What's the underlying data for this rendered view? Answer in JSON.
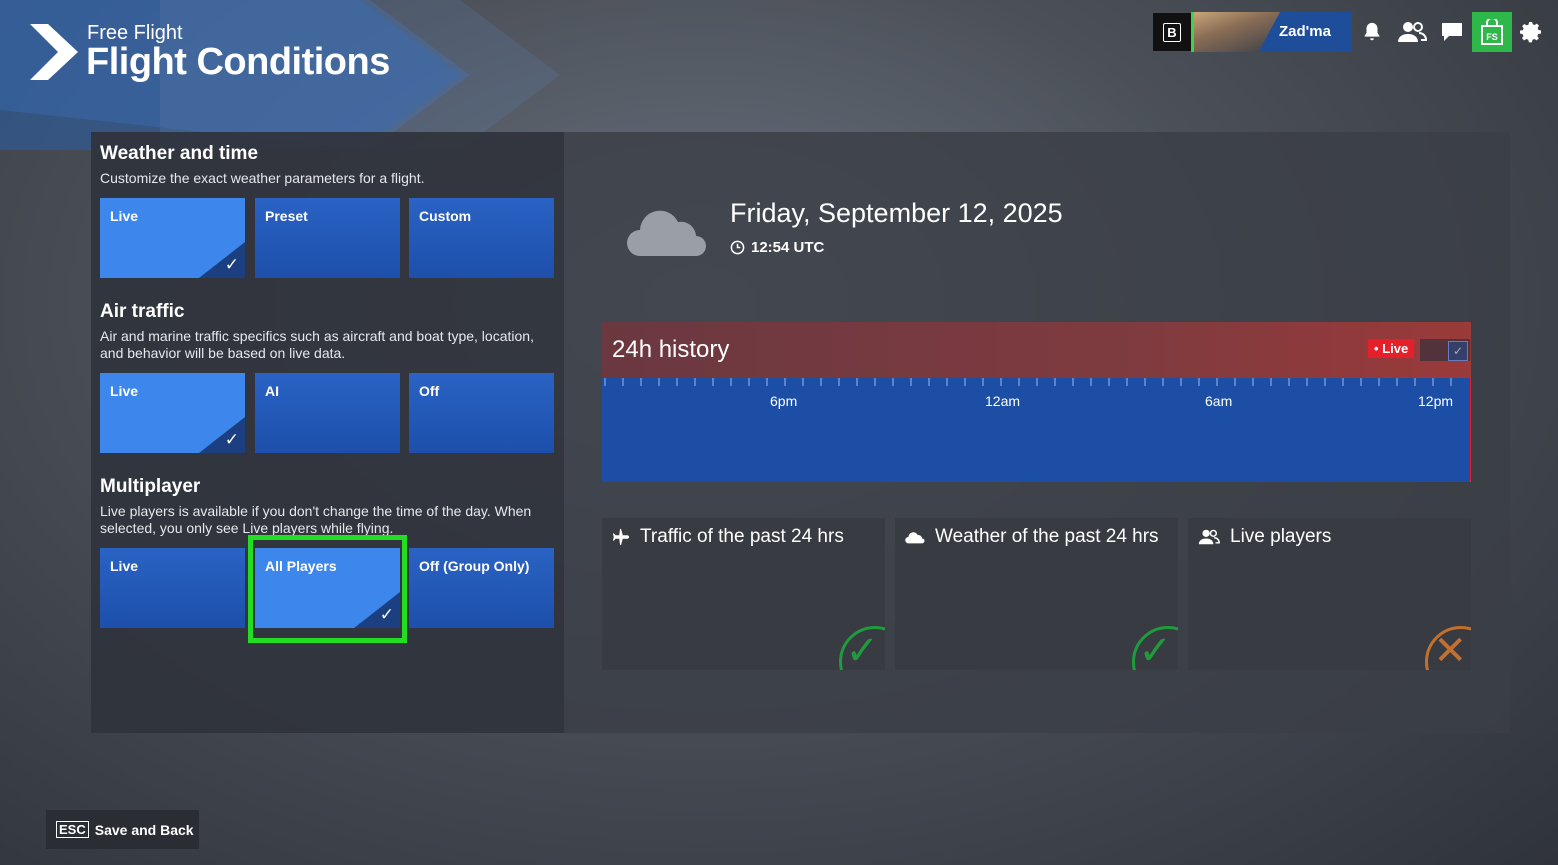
{
  "header": {
    "subtitle": "Free Flight",
    "title": "Flight Conditions"
  },
  "topbar": {
    "button_key": "B",
    "username": "Zad'ma",
    "store_label": "FS"
  },
  "weather_time": {
    "title": "Weather and time",
    "desc": "Customize the exact weather parameters for a flight.",
    "options": [
      "Live",
      "Preset",
      "Custom"
    ],
    "selected": "Live"
  },
  "air_traffic": {
    "title": "Air traffic",
    "desc": "Air and marine traffic specifics such as aircraft and boat type, location, and behavior will be based on live data.",
    "options": [
      "Live",
      "AI",
      "Off"
    ],
    "selected": "Live"
  },
  "multiplayer": {
    "title": "Multiplayer",
    "desc": "Live players is available if you don't change the time of the day. When selected, you only see Live players while flying.",
    "options": [
      "Live",
      "All Players",
      "Off (Group Only)"
    ],
    "selected": "All Players"
  },
  "date_panel": {
    "date": "Friday, September 12, 2025",
    "time": "12:54 UTC"
  },
  "history": {
    "title": "24h history",
    "live_badge": "• Live",
    "labels": [
      "6pm",
      "12am",
      "6am",
      "12pm"
    ]
  },
  "cards": [
    {
      "title": "Traffic of the past 24 hrs",
      "status": "ok",
      "icon": "plane-icon"
    },
    {
      "title": "Weather of the past 24 hrs",
      "status": "ok",
      "icon": "cloud-icon"
    },
    {
      "title": "Live players",
      "status": "unavailable",
      "icon": "players-icon"
    }
  ],
  "colors": {
    "ok": "#1f9b3c",
    "unavailable": "#c4702c",
    "accent": "#2a63c4",
    "focus": "#22dd22"
  },
  "footer": {
    "key": "ESC",
    "label": "Save and Back"
  }
}
